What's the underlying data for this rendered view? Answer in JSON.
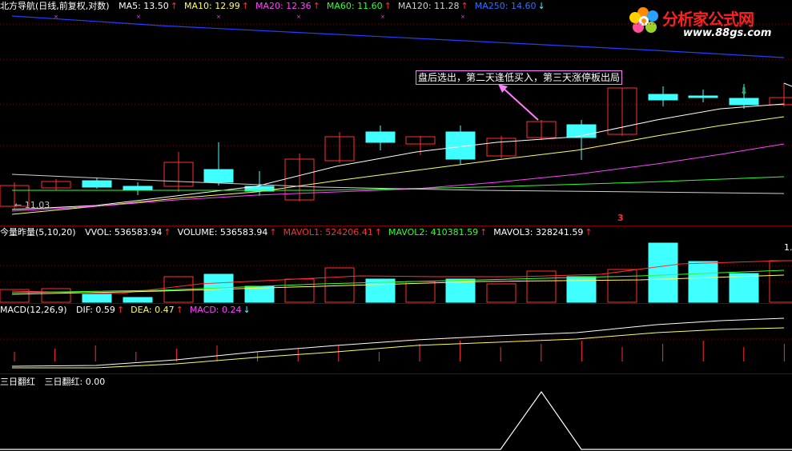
{
  "main": {
    "title": "北方导航(日线,前复权,对数)",
    "indicators": [
      {
        "label": "MA5: 13.50",
        "color": "#ffffff",
        "arrow": "↑",
        "arrow_color": "#ff3030",
        "prefix_arrow": "🠅"
      },
      {
        "label": "MA10: 12.99",
        "color": "#ffff60",
        "arrow": "↑",
        "arrow_color": "#ff3030"
      },
      {
        "label": "MA20: 12.36",
        "color": "#ff44ff",
        "arrow": "↑",
        "arrow_color": "#ff3030"
      },
      {
        "label": "MA60: 11.60",
        "color": "#30ff30",
        "arrow": "↑",
        "arrow_color": "#ff3030"
      },
      {
        "label": "MA120: 11.28",
        "color": "#d0d0d0",
        "arrow": "↑",
        "arrow_color": "#ff3030"
      },
      {
        "label": "MA250: 14.60",
        "color": "#3070ff",
        "arrow": "↓",
        "arrow_color": "#40ffff"
      }
    ],
    "low_label": "← 11.03",
    "marker": "3",
    "annotation": "盘后选出，第二天逢低买入，第三天涨停板出局"
  },
  "volume": {
    "title": "今量昨量(5,10,20)",
    "indicators": [
      {
        "label": "VVOL: 536583.94",
        "color": "#ffffff",
        "arrow": "↑",
        "arrow_color": "#ff3030"
      },
      {
        "label": "VOLUME: 536583.94",
        "color": "#ffffff",
        "arrow": "↑",
        "arrow_color": "#ff3030"
      },
      {
        "label": "MAVOL1: 524206.41",
        "color": "#ff3030",
        "arrow": "↑",
        "arrow_color": "#ff3030"
      },
      {
        "label": "MAVOL2: 410381.59",
        "color": "#30ff30",
        "arrow": "↑",
        "arrow_color": "#ff3030"
      },
      {
        "label": "MAVOL3: 328241.59",
        "color": "#ffffff",
        "arrow": "↑",
        "arrow_color": "#ff3030"
      }
    ],
    "right_label": "1."
  },
  "macd": {
    "title": "MACD(12,26,9)",
    "indicators": [
      {
        "label": "DIF: 0.59",
        "color": "#ffffff",
        "arrow": "↑",
        "arrow_color": "#ff3030"
      },
      {
        "label": "DEA: 0.47",
        "color": "#ffff60",
        "arrow": "↑",
        "arrow_color": "#ff3030"
      },
      {
        "label": "MACD: 0.24",
        "color": "#ff44ff",
        "arrow": "↓",
        "arrow_color": "#40ffff"
      }
    ]
  },
  "sanri": {
    "title": "三日翻红",
    "indicators": [
      {
        "label": "三日翻红: 0.00",
        "color": "#ffffff",
        "arrow": "",
        "arrow_color": "#ff3030"
      }
    ]
  },
  "logo": {
    "text": "分析家公式网",
    "url": "www.88gs.com"
  },
  "colors": {
    "up_candle": "#ff3030",
    "down_candle": "#40ffff",
    "grid": "#7a0000"
  }
}
